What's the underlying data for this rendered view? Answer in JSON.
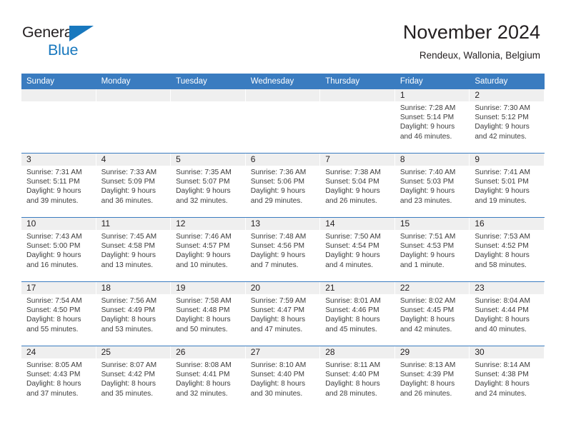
{
  "brand": {
    "name_top": "General",
    "name_bottom": "Blue",
    "triangle_color": "#1878be",
    "text_color": "#231f20"
  },
  "header": {
    "title": "November 2024",
    "location": "Rendeux, Wallonia, Belgium"
  },
  "theme": {
    "header_bar": "#3a7cc0",
    "daynum_strip": "#efefef",
    "row_divider": "#3a7cc0",
    "body_text": "#3c3c3c"
  },
  "weekdays": [
    "Sunday",
    "Monday",
    "Tuesday",
    "Wednesday",
    "Thursday",
    "Friday",
    "Saturday"
  ],
  "weeks": [
    [
      {
        "day": "",
        "sunrise": "",
        "sunset": "",
        "daylight_1": "",
        "daylight_2": ""
      },
      {
        "day": "",
        "sunrise": "",
        "sunset": "",
        "daylight_1": "",
        "daylight_2": ""
      },
      {
        "day": "",
        "sunrise": "",
        "sunset": "",
        "daylight_1": "",
        "daylight_2": ""
      },
      {
        "day": "",
        "sunrise": "",
        "sunset": "",
        "daylight_1": "",
        "daylight_2": ""
      },
      {
        "day": "",
        "sunrise": "",
        "sunset": "",
        "daylight_1": "",
        "daylight_2": ""
      },
      {
        "day": "1",
        "sunrise": "Sunrise: 7:28 AM",
        "sunset": "Sunset: 5:14 PM",
        "daylight_1": "Daylight: 9 hours",
        "daylight_2": "and 46 minutes."
      },
      {
        "day": "2",
        "sunrise": "Sunrise: 7:30 AM",
        "sunset": "Sunset: 5:12 PM",
        "daylight_1": "Daylight: 9 hours",
        "daylight_2": "and 42 minutes."
      }
    ],
    [
      {
        "day": "3",
        "sunrise": "Sunrise: 7:31 AM",
        "sunset": "Sunset: 5:11 PM",
        "daylight_1": "Daylight: 9 hours",
        "daylight_2": "and 39 minutes."
      },
      {
        "day": "4",
        "sunrise": "Sunrise: 7:33 AM",
        "sunset": "Sunset: 5:09 PM",
        "daylight_1": "Daylight: 9 hours",
        "daylight_2": "and 36 minutes."
      },
      {
        "day": "5",
        "sunrise": "Sunrise: 7:35 AM",
        "sunset": "Sunset: 5:07 PM",
        "daylight_1": "Daylight: 9 hours",
        "daylight_2": "and 32 minutes."
      },
      {
        "day": "6",
        "sunrise": "Sunrise: 7:36 AM",
        "sunset": "Sunset: 5:06 PM",
        "daylight_1": "Daylight: 9 hours",
        "daylight_2": "and 29 minutes."
      },
      {
        "day": "7",
        "sunrise": "Sunrise: 7:38 AM",
        "sunset": "Sunset: 5:04 PM",
        "daylight_1": "Daylight: 9 hours",
        "daylight_2": "and 26 minutes."
      },
      {
        "day": "8",
        "sunrise": "Sunrise: 7:40 AM",
        "sunset": "Sunset: 5:03 PM",
        "daylight_1": "Daylight: 9 hours",
        "daylight_2": "and 23 minutes."
      },
      {
        "day": "9",
        "sunrise": "Sunrise: 7:41 AM",
        "sunset": "Sunset: 5:01 PM",
        "daylight_1": "Daylight: 9 hours",
        "daylight_2": "and 19 minutes."
      }
    ],
    [
      {
        "day": "10",
        "sunrise": "Sunrise: 7:43 AM",
        "sunset": "Sunset: 5:00 PM",
        "daylight_1": "Daylight: 9 hours",
        "daylight_2": "and 16 minutes."
      },
      {
        "day": "11",
        "sunrise": "Sunrise: 7:45 AM",
        "sunset": "Sunset: 4:58 PM",
        "daylight_1": "Daylight: 9 hours",
        "daylight_2": "and 13 minutes."
      },
      {
        "day": "12",
        "sunrise": "Sunrise: 7:46 AM",
        "sunset": "Sunset: 4:57 PM",
        "daylight_1": "Daylight: 9 hours",
        "daylight_2": "and 10 minutes."
      },
      {
        "day": "13",
        "sunrise": "Sunrise: 7:48 AM",
        "sunset": "Sunset: 4:56 PM",
        "daylight_1": "Daylight: 9 hours",
        "daylight_2": "and 7 minutes."
      },
      {
        "day": "14",
        "sunrise": "Sunrise: 7:50 AM",
        "sunset": "Sunset: 4:54 PM",
        "daylight_1": "Daylight: 9 hours",
        "daylight_2": "and 4 minutes."
      },
      {
        "day": "15",
        "sunrise": "Sunrise: 7:51 AM",
        "sunset": "Sunset: 4:53 PM",
        "daylight_1": "Daylight: 9 hours",
        "daylight_2": "and 1 minute."
      },
      {
        "day": "16",
        "sunrise": "Sunrise: 7:53 AM",
        "sunset": "Sunset: 4:52 PM",
        "daylight_1": "Daylight: 8 hours",
        "daylight_2": "and 58 minutes."
      }
    ],
    [
      {
        "day": "17",
        "sunrise": "Sunrise: 7:54 AM",
        "sunset": "Sunset: 4:50 PM",
        "daylight_1": "Daylight: 8 hours",
        "daylight_2": "and 55 minutes."
      },
      {
        "day": "18",
        "sunrise": "Sunrise: 7:56 AM",
        "sunset": "Sunset: 4:49 PM",
        "daylight_1": "Daylight: 8 hours",
        "daylight_2": "and 53 minutes."
      },
      {
        "day": "19",
        "sunrise": "Sunrise: 7:58 AM",
        "sunset": "Sunset: 4:48 PM",
        "daylight_1": "Daylight: 8 hours",
        "daylight_2": "and 50 minutes."
      },
      {
        "day": "20",
        "sunrise": "Sunrise: 7:59 AM",
        "sunset": "Sunset: 4:47 PM",
        "daylight_1": "Daylight: 8 hours",
        "daylight_2": "and 47 minutes."
      },
      {
        "day": "21",
        "sunrise": "Sunrise: 8:01 AM",
        "sunset": "Sunset: 4:46 PM",
        "daylight_1": "Daylight: 8 hours",
        "daylight_2": "and 45 minutes."
      },
      {
        "day": "22",
        "sunrise": "Sunrise: 8:02 AM",
        "sunset": "Sunset: 4:45 PM",
        "daylight_1": "Daylight: 8 hours",
        "daylight_2": "and 42 minutes."
      },
      {
        "day": "23",
        "sunrise": "Sunrise: 8:04 AM",
        "sunset": "Sunset: 4:44 PM",
        "daylight_1": "Daylight: 8 hours",
        "daylight_2": "and 40 minutes."
      }
    ],
    [
      {
        "day": "24",
        "sunrise": "Sunrise: 8:05 AM",
        "sunset": "Sunset: 4:43 PM",
        "daylight_1": "Daylight: 8 hours",
        "daylight_2": "and 37 minutes."
      },
      {
        "day": "25",
        "sunrise": "Sunrise: 8:07 AM",
        "sunset": "Sunset: 4:42 PM",
        "daylight_1": "Daylight: 8 hours",
        "daylight_2": "and 35 minutes."
      },
      {
        "day": "26",
        "sunrise": "Sunrise: 8:08 AM",
        "sunset": "Sunset: 4:41 PM",
        "daylight_1": "Daylight: 8 hours",
        "daylight_2": "and 32 minutes."
      },
      {
        "day": "27",
        "sunrise": "Sunrise: 8:10 AM",
        "sunset": "Sunset: 4:40 PM",
        "daylight_1": "Daylight: 8 hours",
        "daylight_2": "and 30 minutes."
      },
      {
        "day": "28",
        "sunrise": "Sunrise: 8:11 AM",
        "sunset": "Sunset: 4:40 PM",
        "daylight_1": "Daylight: 8 hours",
        "daylight_2": "and 28 minutes."
      },
      {
        "day": "29",
        "sunrise": "Sunrise: 8:13 AM",
        "sunset": "Sunset: 4:39 PM",
        "daylight_1": "Daylight: 8 hours",
        "daylight_2": "and 26 minutes."
      },
      {
        "day": "30",
        "sunrise": "Sunrise: 8:14 AM",
        "sunset": "Sunset: 4:38 PM",
        "daylight_1": "Daylight: 8 hours",
        "daylight_2": "and 24 minutes."
      }
    ]
  ]
}
